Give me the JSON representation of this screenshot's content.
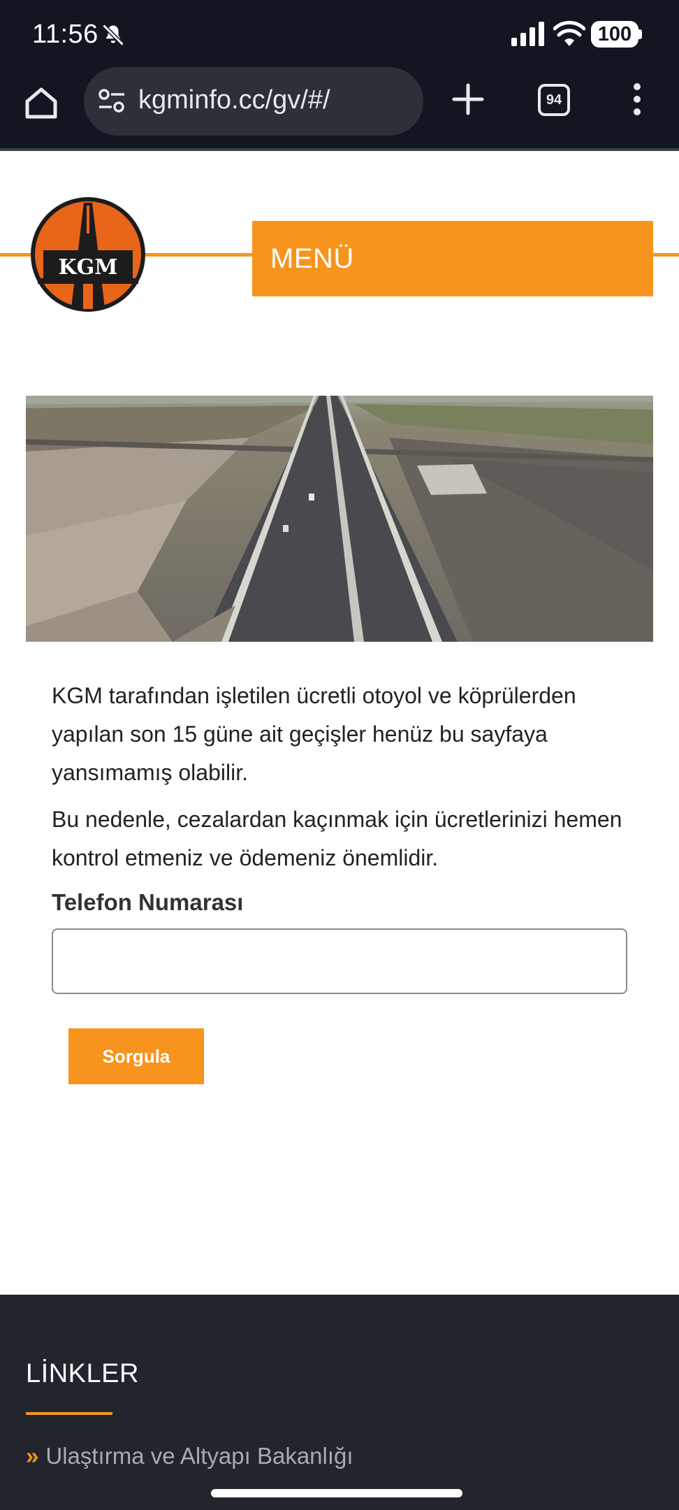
{
  "status_bar": {
    "time": "11:56",
    "battery": "100"
  },
  "browser": {
    "url": "kgminfo.cc/gv/#/",
    "tab_count": "94"
  },
  "header": {
    "logo_text": "KGM",
    "menu_label": "MENÜ"
  },
  "main": {
    "paragraph1": "KGM tarafından işletilen ücretli otoyol ve köprülerden yapılan son 15 güne ait geçişler henüz bu sayfaya yansımamış olabilir.",
    "paragraph2": "Bu nedenle, cezalardan kaçınmak için ücretlerinizi hemen kontrol etmeniz ve ödemeniz önemlidir.",
    "phone_label": "Telefon Numarası",
    "phone_value": "",
    "submit_label": "Sorgula"
  },
  "footer": {
    "title": "LİNKLER",
    "links": [
      {
        "label": "Ulaştırma ve Altyapı Bakanlığı"
      }
    ]
  },
  "colors": {
    "accent": "#f7941d",
    "chrome_bg": "#121620",
    "footer_bg": "#23252e"
  }
}
